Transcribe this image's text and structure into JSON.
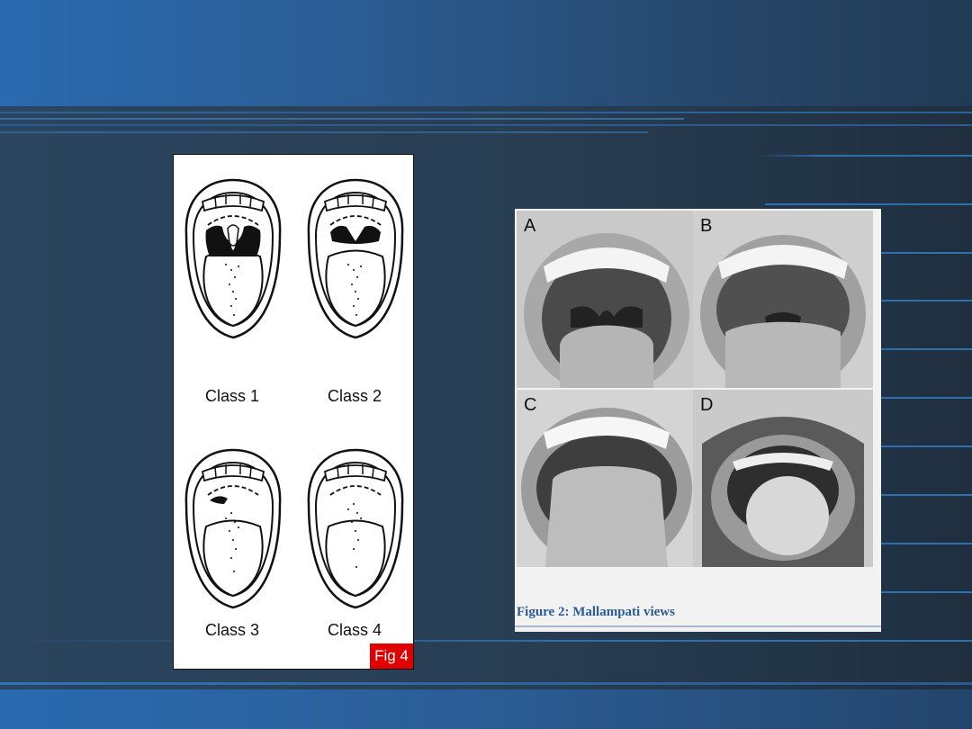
{
  "left_figure": {
    "labels": [
      "Class 1",
      "Class 2",
      "Class 3",
      "Class 4"
    ],
    "tag": "Fig 4",
    "tag_color": "#e00000"
  },
  "right_figure": {
    "panels": [
      "A",
      "B",
      "C",
      "D"
    ],
    "caption": "Figure 2: Mallampati views",
    "caption_color": "#2a5a9a"
  },
  "colors": {
    "header": "#2a6ab0",
    "background": "#2a3d52",
    "accent_line": "#2f6fb0"
  }
}
